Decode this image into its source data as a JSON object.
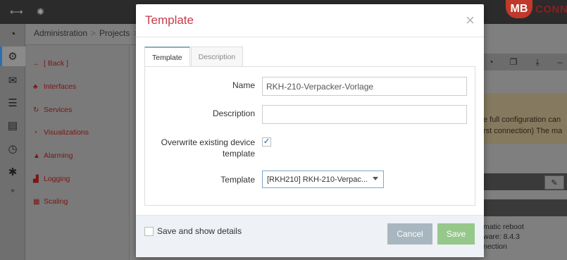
{
  "app": {
    "brand_logo": "MB",
    "brand_name": "CONNE"
  },
  "topbar": {
    "icons": [
      "collapse-arrows-icon",
      "spinner-icon"
    ]
  },
  "iconbar": {
    "items": [
      "dashboard-icon",
      "cogs-icon",
      "envelope-icon",
      "server-icon",
      "book-icon",
      "clock-icon",
      "gear-icon",
      "expand-icon"
    ]
  },
  "breadcrumb": {
    "items": [
      "Administration",
      "Projects"
    ],
    "separator": ">"
  },
  "leftnav": {
    "items": [
      {
        "label": "[ Back ]",
        "icon": "arrow-left-icon"
      },
      {
        "label": "Interfaces",
        "icon": "sitemap-icon"
      },
      {
        "label": "Services",
        "icon": "refresh-icon"
      },
      {
        "label": "Visualizations",
        "icon": "dashboard-icon"
      },
      {
        "label": "Alarming",
        "icon": "warning-icon"
      },
      {
        "label": "Logging",
        "icon": "chart-icon"
      },
      {
        "label": "Scaling",
        "icon": "calculator-icon"
      }
    ]
  },
  "right_panel": {
    "warning_line1": "e full configuration can",
    "warning_line2": "rst connection) The ma",
    "info_line1": "matic reboot",
    "info_line2": "ware: 8.4.3",
    "info_line3": "nection"
  },
  "modal": {
    "title": "Template",
    "close_symbol": "×",
    "tabs": [
      {
        "label": "Template",
        "active": true
      },
      {
        "label": "Description",
        "active": false
      }
    ],
    "fields": {
      "name_label": "Name",
      "name_value": "RKH-210-Verpacker-Vorlage",
      "description_label": "Description",
      "description_value": "",
      "overwrite_label_line1": "Overwrite existing device",
      "overwrite_label_line2": "template",
      "overwrite_checked": true,
      "template_label": "Template",
      "template_selected": "[RKH210] RKH-210-Verpac..."
    },
    "footer": {
      "save_details_label": "Save and show details",
      "save_details_checked": false,
      "cancel_label": "Cancel",
      "save_label": "Save"
    }
  },
  "colors": {
    "title": "#c9394a",
    "cancel_button": "#a7b6bf",
    "save_button": "#96c78b",
    "checkmark": "#4a8bc2",
    "nav_text": "#7c1414"
  }
}
